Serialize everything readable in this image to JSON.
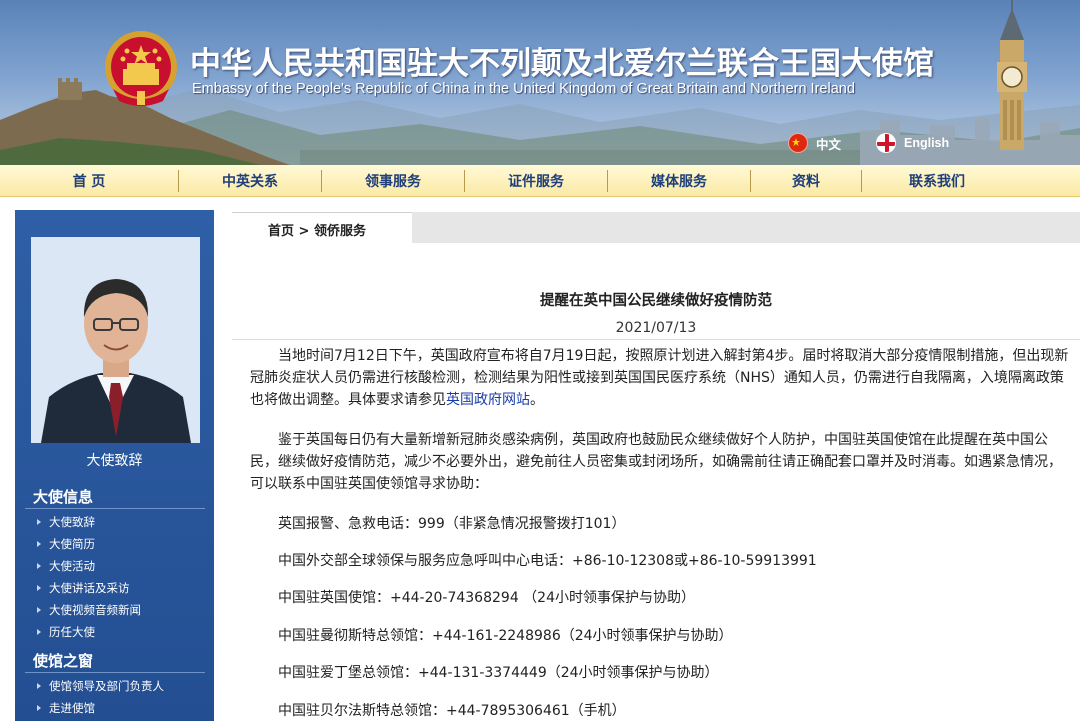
{
  "header": {
    "title_cn": "中华人民共和国驻大不列颠及北爱尔兰联合王国大使馆",
    "title_en": "Embassy of the People's Republic of China in the United Kingdom of Great Britain and Northern Ireland",
    "lang_cn": "中文",
    "lang_en": "English"
  },
  "nav": {
    "items": [
      "首 页",
      "中英关系",
      "领事服务",
      "证件服务",
      "媒体服务",
      "资料",
      "联系我们"
    ]
  },
  "sidebar": {
    "portrait_caption": "大使致辞",
    "section1_title": "大使信息",
    "section1_items": [
      "大使致辞",
      "大使简历",
      "大使活动",
      "大使讲话及采访",
      "大使视频音频新闻",
      "历任大使"
    ],
    "section2_title": "使馆之窗",
    "section2_items": [
      "使馆领导及部门负责人",
      "走进使馆"
    ]
  },
  "breadcrumb": {
    "home": "首页",
    "separator": " > ",
    "current": "领侨服务"
  },
  "article": {
    "title": "提醒在英中国公民继续做好疫情防范",
    "date": "2021/07/13",
    "p1_text": "当地时间7月12日下午，英国政府宣布将自7月19日起，按照原计划进入解封第4步。届时将取消大部分疫情限制措施，但出现新冠肺炎症状人员仍需进行核酸检测，检测结果为阳性或接到英国国民医疗系统（NHS）通知人员，仍需进行自我隔离，入境隔离政策也将做出调整。具体要求请参见",
    "p1_link": "英国政府网站",
    "p1_end": "。",
    "p2_text": "鉴于英国每日仍有大量新增新冠肺炎感染病例，英国政府也鼓励民众继续做好个人防护，中国驻英国使馆在此提醒在英中国公民，继续做好疫情防范，减少不必要外出，避免前往人员密集或封闭场所，如确需前往请正确配套口罩并及时消毒。如遇紧急情况，可以联系中国驻英国使领馆寻求协助：",
    "contacts": [
      "英国报警、急救电话：999（非紧急情况报警拨打101）",
      "中国外交部全球领保与服务应急呼叫中心电话：+86-10-12308或+86-10-59913991",
      "中国驻英国使馆：+44-20-74368294 （24小时领事保护与协助）",
      "中国驻曼彻斯特总领馆：+44-161-2248986（24小时领事保护与协助）",
      "中国驻爱丁堡总领馆：+44-131-3374449（24小时领事保护与协助）",
      "中国驻贝尔法斯特总领馆：+44-7895306461（手机）"
    ]
  },
  "colors": {
    "nav_text": "#1f3f7a",
    "sidebar_bg": "#2f5fa6",
    "link": "#1a3ea8"
  }
}
